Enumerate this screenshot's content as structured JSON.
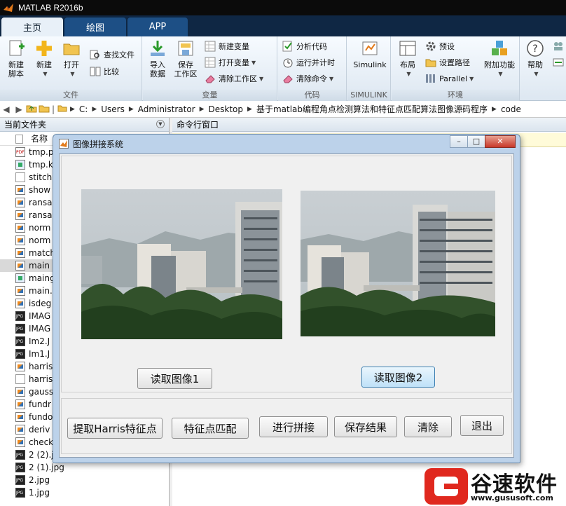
{
  "window": {
    "title": "MATLAB R2016b"
  },
  "tabs": [
    {
      "label": "主页"
    },
    {
      "label": "绘图"
    },
    {
      "label": "APP"
    }
  ],
  "ribbon": {
    "file_group": {
      "label": "文件",
      "new_script": "新建\n脚本",
      "new": "新建",
      "open": "打开",
      "find_files": "查找文件",
      "compare": "比较"
    },
    "variable_group": {
      "label": "变量",
      "import_data": "导入\n数据",
      "save_workspace": "保存\n工作区",
      "new_variable": "新建变量",
      "open_variable": "打开变量",
      "clear_workspace": "清除工作区"
    },
    "code_group": {
      "label": "代码",
      "analyze_code": "分析代码",
      "run_and_time": "运行并计时",
      "clear_commands": "清除命令"
    },
    "simulink_group": {
      "label": "SIMULINK",
      "simulink": "Simulink"
    },
    "environment_group": {
      "label": "环境",
      "layout": "布局",
      "preferences": "预设",
      "set_path": "设置路径",
      "parallel": "Parallel",
      "addons": "附加功能"
    },
    "resources_group": {
      "help": "帮助"
    }
  },
  "address": {
    "crumbs": [
      "C:",
      "Users",
      "Administrator",
      "Desktop",
      "基于matlab编程角点检测算法和特征点匹配算法图像源码程序",
      "code"
    ]
  },
  "current_folder": {
    "title": "当前文件夹",
    "column_name": "名称",
    "files": [
      {
        "name": "tmp.p",
        "icon": "pdf"
      },
      {
        "name": "tmp.k",
        "icon": "fig"
      },
      {
        "name": "stitch",
        "icon": "blank"
      },
      {
        "name": "show",
        "icon": "m"
      },
      {
        "name": "ransa",
        "icon": "m"
      },
      {
        "name": "ransa",
        "icon": "m"
      },
      {
        "name": "norm",
        "icon": "m"
      },
      {
        "name": "norm",
        "icon": "m"
      },
      {
        "name": "match",
        "icon": "m"
      },
      {
        "name": "main",
        "icon": "m"
      },
      {
        "name": "maing",
        "icon": "fig"
      },
      {
        "name": "main.",
        "icon": "m"
      },
      {
        "name": "isdeg",
        "icon": "m"
      },
      {
        "name": "IMAG",
        "icon": "jpg"
      },
      {
        "name": "IMAG",
        "icon": "jpg"
      },
      {
        "name": "Im2.J",
        "icon": "jpg"
      },
      {
        "name": "Im1.J",
        "icon": "jpg"
      },
      {
        "name": "harris",
        "icon": "m"
      },
      {
        "name": "harris",
        "icon": "blank"
      },
      {
        "name": "gauss",
        "icon": "m"
      },
      {
        "name": "fundr",
        "icon": "m"
      },
      {
        "name": "fundo",
        "icon": "m"
      },
      {
        "name": "deriv",
        "icon": "m"
      },
      {
        "name": "check",
        "icon": "m"
      },
      {
        "name": "2 (2).jp",
        "icon": "jpg"
      },
      {
        "name": "2 (1).jpg",
        "icon": "jpg"
      },
      {
        "name": "2.jpg",
        "icon": "jpg"
      },
      {
        "name": "1.jpg",
        "icon": "jpg"
      }
    ]
  },
  "command_window": {
    "title": "命令行窗口"
  },
  "dialog": {
    "title": "图像拼接系统",
    "read_image1": "读取图像1",
    "read_image2": "读取图像2",
    "extract_harris": "提取Harris特征点",
    "match_features": "特征点匹配",
    "stitch": "进行拼接",
    "save_result": "保存结果",
    "clear": "清除",
    "exit": "退出"
  },
  "watermark": {
    "brand": "谷速软件",
    "url": "www.gususoft.com"
  },
  "colors": {
    "accent": "#1d4f85",
    "active_tab": "#e8f0f8",
    "titlebar": "#0b0b0b",
    "watermark_red": "#e0281e"
  }
}
